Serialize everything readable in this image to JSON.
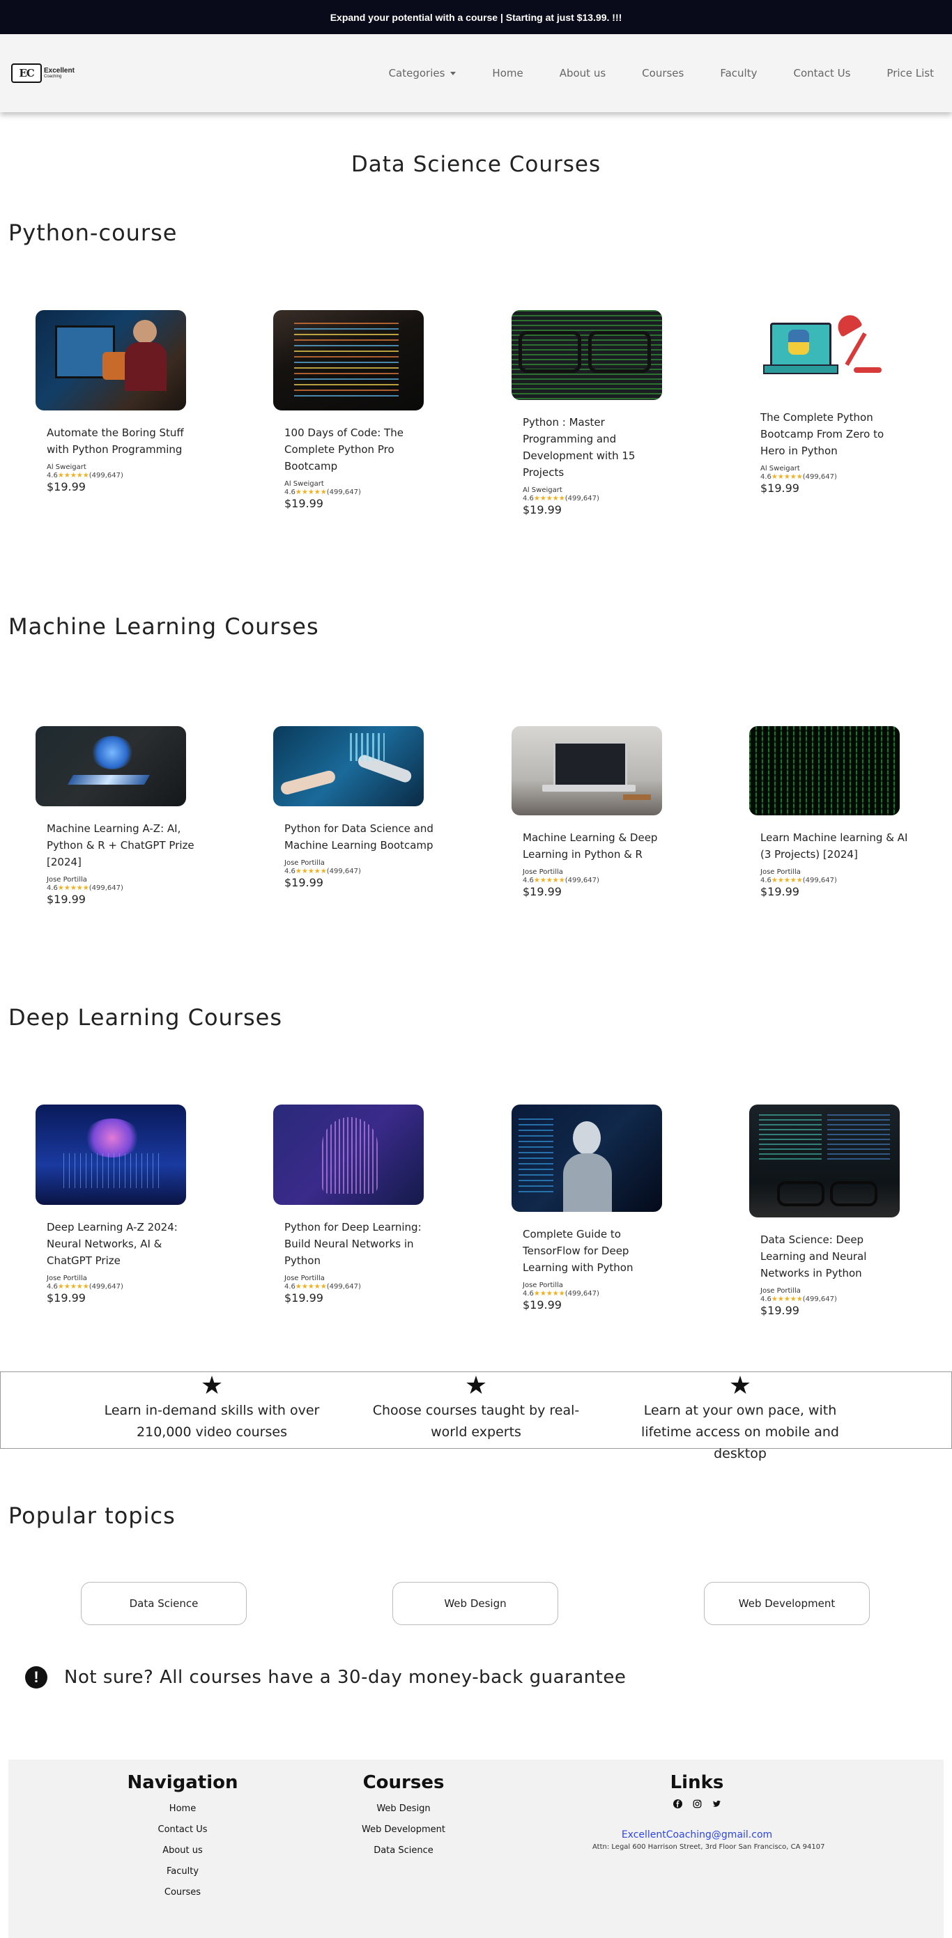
{
  "topbar": {
    "text": "Expand your potential with a course | Starting at just $13.99. !!!"
  },
  "logo": {
    "mark": "EC",
    "line1": "Excellent",
    "line2": "Coaching"
  },
  "nav": {
    "items": [
      "Categories",
      "Home",
      "About us",
      "Courses",
      "Faculty",
      "Contact Us",
      "Price List"
    ]
  },
  "page": {
    "title": "Data Science Courses"
  },
  "sections": [
    {
      "title": "Python-course",
      "cards": [
        {
          "title": "Automate the Boring Stuff with Python Programming",
          "author": "Al Sweigart",
          "rating": "4.6",
          "stars": "★★★★★",
          "reviews": "(499,647)",
          "price": "$19.99",
          "image": "person-at-desk-monitor"
        },
        {
          "title": "100 Days of Code: The Complete Python Pro Bootcamp",
          "author": "Al Sweigart",
          "rating": "4.6",
          "stars": "★★★★★",
          "reviews": "(499,647)",
          "price": "$19.99",
          "image": "code-on-screen"
        },
        {
          "title": "Python : Master Programming and Development with 15 Projects",
          "author": "Al Sweigart",
          "rating": "4.6",
          "stars": "★★★★★",
          "reviews": "(499,647)",
          "price": "$19.99",
          "image": "glasses-green-code"
        },
        {
          "title": "The Complete Python Bootcamp From Zero to Hero in Python",
          "author": "Al Sweigart",
          "rating": "4.6",
          "stars": "★★★★★",
          "reviews": "(499,647)",
          "price": "$19.99",
          "image": "python-laptop-lamp"
        }
      ]
    },
    {
      "title": "Machine Learning Courses",
      "cards": [
        {
          "title": "Machine Learning A-Z: AI, Python & R + ChatGPT Prize [2024]",
          "author": "Jose Portilla",
          "rating": "4.6",
          "stars": "★★★★★",
          "reviews": "(499,647)",
          "price": "$19.99",
          "image": "glowing-brain-chip"
        },
        {
          "title": "Python for Data Science and Machine Learning Bootcamp",
          "author": "Jose Portilla",
          "rating": "4.6",
          "stars": "★★★★★",
          "reviews": "(499,647)",
          "price": "$19.99",
          "image": "robot-human-hands"
        },
        {
          "title": "Machine Learning & Deep Learning in Python & R",
          "author": "Jose Portilla",
          "rating": "4.6",
          "stars": "★★★★★",
          "reviews": "(499,647)",
          "price": "$19.99",
          "image": "laptop-on-desk"
        },
        {
          "title": "Learn Machine learning & AI (3 Projects) [2024]",
          "author": "Jose Portilla",
          "rating": "4.6",
          "stars": "★★★★★",
          "reviews": "(499,647)",
          "price": "$19.99",
          "image": "green-matrix-code"
        }
      ]
    },
    {
      "title": "Deep Learning Courses",
      "cards": [
        {
          "title": "Deep Learning A-Z 2024: Neural Networks, AI & ChatGPT Prize",
          "author": "Jose Portilla",
          "rating": "4.6",
          "stars": "★★★★★",
          "reviews": "(499,647)",
          "price": "$19.99",
          "image": "neural-brain-blue"
        },
        {
          "title": "Python for Deep Learning: Build Neural Networks in Python",
          "author": "Jose Portilla",
          "rating": "4.6",
          "stars": "★★★★★",
          "reviews": "(499,647)",
          "price": "$19.99",
          "image": "digital-head-purple"
        },
        {
          "title": "Complete Guide to TensorFlow for Deep Learning with Python",
          "author": "Jose Portilla",
          "rating": "4.6",
          "stars": "★★★★★",
          "reviews": "(499,647)",
          "price": "$19.99",
          "image": "robot-thinking"
        },
        {
          "title": "Data Science: Deep Learning and Neural Networks in Python",
          "author": "Jose Portilla",
          "rating": "4.6",
          "stars": "★★★★★",
          "reviews": "(499,647)",
          "price": "$19.99",
          "image": "monitors-glasses"
        }
      ]
    }
  ],
  "features": [
    {
      "icon": "star-icon",
      "text": "Learn in-demand skills with over 210,000 video courses"
    },
    {
      "icon": "star-icon",
      "text": "Choose courses taught by real-world experts"
    },
    {
      "icon": "star-icon",
      "text": "Learn at your own pace, with lifetime access on mobile and desktop"
    }
  ],
  "popular": {
    "title": "Popular topics",
    "topics": [
      "Data Science",
      "Web Design",
      "Web Development"
    ]
  },
  "guarantee": {
    "icon": "!",
    "text": "Not sure? All courses have a 30-day money-back guarantee"
  },
  "footer": {
    "navigation": {
      "title": "Navigation",
      "links": [
        "Home",
        "Contact Us",
        "About us",
        "Faculty",
        "Courses"
      ]
    },
    "courses": {
      "title": "Courses",
      "links": [
        "Web Design",
        "Web Development",
        "Data Science"
      ]
    },
    "links": {
      "title": "Links",
      "social": [
        "facebook-icon",
        "instagram-icon",
        "twitter-icon"
      ],
      "email": "ExcellentCoaching@gmail.com",
      "address": "Attn: Legal 600 Harrison Street, 3rd Floor San Francisco, CA 94107"
    }
  },
  "colors": {
    "topbar": "#0a0b1a",
    "navbar": "#f4f4f4",
    "star": "#f2b01e",
    "email": "#2d46e8",
    "footer": "#f2f2f2"
  }
}
